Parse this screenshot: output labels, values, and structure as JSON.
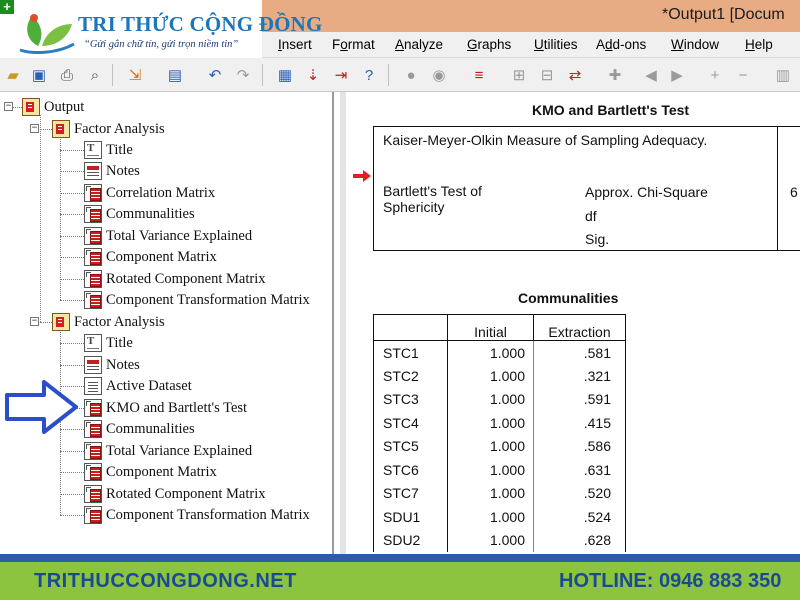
{
  "window": {
    "title": "*Output1 [Docum"
  },
  "logo": {
    "brand": "TRI THỨC CỘNG ĐỒNG",
    "slogan": "“Gửi gắn chữ tín, gửi trọn niềm tin”"
  },
  "menu": [
    {
      "label": "Insert",
      "u": "I",
      "rest": "nsert"
    },
    {
      "label": "Format",
      "u": "o",
      "pre": "F",
      "rest": "rmat"
    },
    {
      "label": "Analyze",
      "u": "A",
      "rest": "nalyze"
    },
    {
      "label": "Graphs",
      "u": "G",
      "rest": "raphs"
    },
    {
      "label": "Utilities",
      "u": "U",
      "rest": "tilities"
    },
    {
      "label": "Add-ons",
      "u": "d",
      "pre": "A",
      "rest": "d-ons"
    },
    {
      "label": "Window",
      "u": "W",
      "rest": "indow"
    },
    {
      "label": "Help",
      "u": "H",
      "rest": "elp"
    }
  ],
  "outline": {
    "root": "Output",
    "groups": [
      {
        "label": "Factor Analysis",
        "items": [
          "Title",
          "Notes",
          "Correlation Matrix",
          "Communalities",
          "Total Variance Explained",
          "Component Matrix",
          "Rotated Component Matrix",
          "Component Transformation Matrix"
        ]
      },
      {
        "label": "Factor Analysis",
        "items": [
          "Title",
          "Notes",
          "Active Dataset",
          "KMO and Bartlett's Test",
          "Communalities",
          "Total Variance Explained",
          "Component Matrix",
          "Rotated Component Matrix",
          "Component Transformation Matrix"
        ]
      }
    ]
  },
  "kmo": {
    "title": "KMO and Bartlett's Test",
    "kmo_label": "Kaiser-Meyer-Olkin Measure of Sampling Adequacy.",
    "bartlett_label": "Bartlett's Test of Sphericity",
    "rows": [
      "Approx. Chi-Square",
      "df",
      "Sig."
    ],
    "value_fragment": "6"
  },
  "communalities": {
    "title": "Communalities",
    "headers": [
      "Initial",
      "Extraction"
    ],
    "rows": [
      {
        "name": "STC1",
        "initial": "1.000",
        "extraction": ".581"
      },
      {
        "name": "STC2",
        "initial": "1.000",
        "extraction": ".321"
      },
      {
        "name": "STC3",
        "initial": "1.000",
        "extraction": ".591"
      },
      {
        "name": "STC4",
        "initial": "1.000",
        "extraction": ".415"
      },
      {
        "name": "STC5",
        "initial": "1.000",
        "extraction": ".586"
      },
      {
        "name": "STC6",
        "initial": "1.000",
        "extraction": ".631"
      },
      {
        "name": "STC7",
        "initial": "1.000",
        "extraction": ".520"
      },
      {
        "name": "SDU1",
        "initial": "1.000",
        "extraction": ".524"
      },
      {
        "name": "SDU2",
        "initial": "1.000",
        "extraction": ".628"
      }
    ]
  },
  "footer": {
    "website": "TRITHUCCONGDONG.NET",
    "hotline": "HOTLINE: 0946 883 350"
  },
  "colors": {
    "titlebar": "#e8ac85",
    "footer": "#8cc440",
    "footer_text": "#1b4a95",
    "brand": "#1d76b8"
  }
}
